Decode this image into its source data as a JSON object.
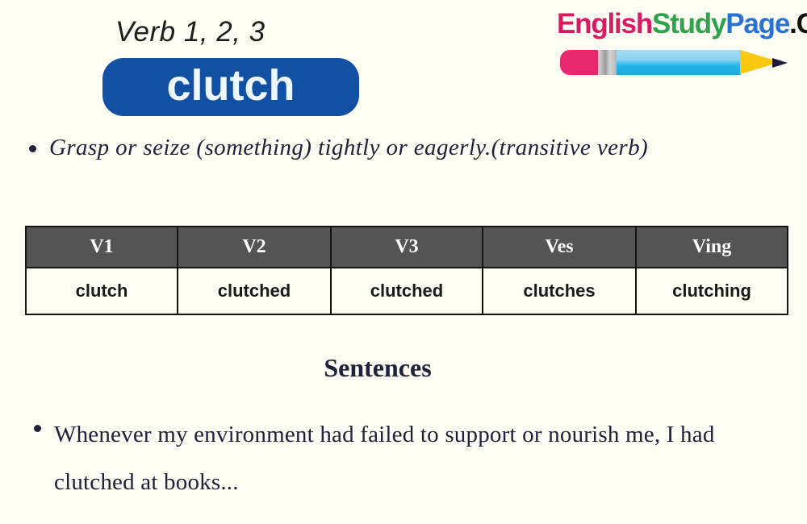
{
  "page": {
    "background_color": "#fdfdf3",
    "text_color": "#20213a"
  },
  "header": {
    "kicker": "Verb 1, 2, 3",
    "word_badge": {
      "label": "clutch",
      "background_color": "#1250a4",
      "text_color": "#eef7fe"
    }
  },
  "brand": {
    "parts": {
      "english": "English",
      "study": "Study",
      "page": "Page",
      "com": ".Com"
    },
    "colors": {
      "english": "#d81b60",
      "study": "#2fa34b",
      "page": "#2872d6",
      "com": "#101010"
    },
    "pencil": {
      "eraser_color": "#e8286c",
      "ferrule_color": "#b0b0b0",
      "body_color": "#25b6e8",
      "tip_color": "#f9c811",
      "lead_color": "#1b1b3a"
    }
  },
  "definition": {
    "items": [
      "Grasp or seize (something) tightly or eagerly.(transitive verb)"
    ]
  },
  "table": {
    "header_background": "#545454",
    "headers": [
      "V1",
      "V2",
      "V3",
      "Ves",
      "Ving"
    ],
    "rows": [
      [
        "clutch",
        "clutched",
        "clutched",
        "clutches",
        "clutching"
      ]
    ]
  },
  "sentences": {
    "heading": "Sentences",
    "items": [
      "Whenever my environment had failed to support or nourish me, I had clutched at books..."
    ]
  }
}
